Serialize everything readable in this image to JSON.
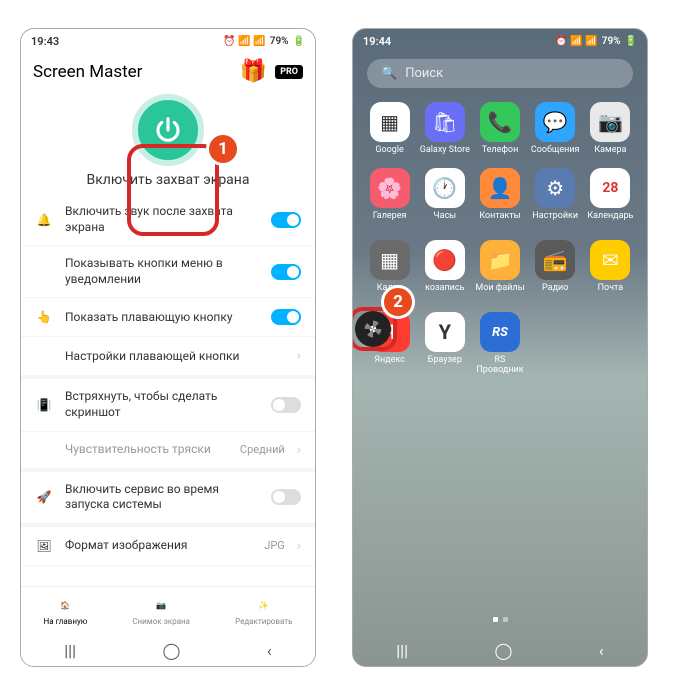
{
  "p1": {
    "time": "19:43",
    "battery": "79%",
    "title": "Screen Master",
    "pro": "PRO",
    "caption": "Включить захват экрана",
    "callout": "1",
    "rows": {
      "sound": "Включить звук после захвата экрана",
      "menu": "Показывать кнопки меню в уведомлении",
      "float": "Показать плавающую кнопку",
      "float_settings": "Настройки плавающей кнопки",
      "shake": "Встряхнуть, чтобы сделать скриншот",
      "sens_label": "Чувствительность тряски",
      "sens_val": "Средний",
      "boot": "Включить сервис во время запуска системы",
      "format_label": "Формат изображения",
      "format_val": "JPG"
    },
    "nav": {
      "home": "На главную",
      "shot": "Снимок экрана",
      "edit": "Редактировать"
    }
  },
  "p2": {
    "time": "19:44",
    "battery": "79%",
    "search": "Поиск",
    "callout": "2",
    "apps": [
      {
        "label": "Google",
        "bg": "#fff",
        "txt": "▦"
      },
      {
        "label": "Galaxy Store",
        "bg": "#6a6ff5",
        "txt": "🛍"
      },
      {
        "label": "Телефон",
        "bg": "#34c759",
        "txt": "📞"
      },
      {
        "label": "Сообщения",
        "bg": "#2ea6ff",
        "txt": "💬"
      },
      {
        "label": "Камера",
        "bg": "#e9e9e9",
        "txt": "📷"
      },
      {
        "label": "Галерея",
        "bg": "#f55d6f",
        "txt": "🌸"
      },
      {
        "label": "Часы",
        "bg": "#fff",
        "txt": "🕐"
      },
      {
        "label": "Контакты",
        "bg": "#ff8a3c",
        "txt": "👤"
      },
      {
        "label": "Настройки",
        "bg": "#5a7bb0",
        "txt": "⚙"
      },
      {
        "label": "Календарь",
        "bg": "#fff",
        "txt": "28"
      },
      {
        "label": "Кальк",
        "bg": "#6b6b6b",
        "txt": "▦"
      },
      {
        "label": "козапись",
        "bg": "#fff",
        "txt": "🔴"
      },
      {
        "label": "Мои файлы",
        "bg": "#ffb03a",
        "txt": "📁"
      },
      {
        "label": "Радио",
        "bg": "#5a5a5a",
        "txt": "📻"
      },
      {
        "label": "Почта",
        "bg": "#ffcc00",
        "txt": "✉"
      },
      {
        "label": "Яндекс",
        "bg": "#ff3b30",
        "txt": "Я"
      },
      {
        "label": "Браузер",
        "bg": "#fff",
        "txt": "Y"
      },
      {
        "label": "RS Проводник",
        "bg": "#2d6ed6",
        "txt": "RS"
      }
    ]
  }
}
